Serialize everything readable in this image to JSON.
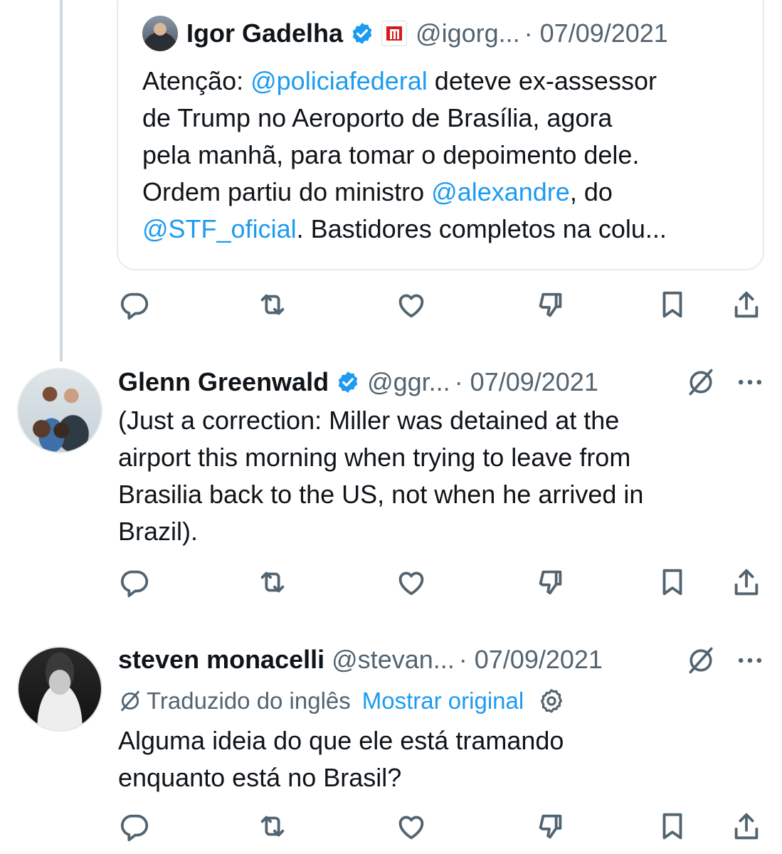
{
  "quoted_tweet": {
    "name": "Igor Gadelha",
    "handle": "@igorg...",
    "date": "· 07/09/2021",
    "lines": [
      [
        {
          "t": "Atenção: ",
          "m": false
        },
        {
          "t": "@policiafederal",
          "m": true
        },
        {
          "t": " deteve ex-assessor",
          "m": false
        }
      ],
      [
        {
          "t": "de Trump  no Aeroporto de Brasília, agora",
          "m": false
        }
      ],
      [
        {
          "t": "pela manhã, para tomar o depoimento dele.",
          "m": false
        }
      ],
      [
        {
          "t": "Ordem partiu do ministro ",
          "m": false
        },
        {
          "t": "@alexandre",
          "m": true
        },
        {
          "t": ", do",
          "m": false
        }
      ],
      [
        {
          "t": "@STF_oficial",
          "m": true
        },
        {
          "t": ". Bastidores completos na colu...",
          "m": false
        }
      ]
    ]
  },
  "tweets": [
    {
      "name": "Glenn Greenwald",
      "handle": "@ggr...",
      "date": "· 07/09/2021",
      "verified": true,
      "lines": [
        "(Just a correction: Miller was detained at the",
        "airport this morning when trying to leave from",
        "Brasilia back to the US, not when he arrived in",
        "Brazil)."
      ]
    },
    {
      "name": "steven monacelli",
      "handle": "@stevan...",
      "date": "· 07/09/2021",
      "verified": false,
      "translation_label": "Traduzido do inglês",
      "show_original": "Mostrar original",
      "lines": [
        "Alguma ideia do que ele está tramando",
        "enquanto está no Brasil?"
      ]
    }
  ],
  "icons": [
    "reply-icon",
    "retweet-icon",
    "like-icon",
    "dislike-icon",
    "bookmark-icon",
    "share-icon",
    "grok-icon",
    "more-icon",
    "verified-badge-icon",
    "gear-icon"
  ],
  "colors": {
    "accent": "#1d9bf0",
    "muted": "#536471",
    "text": "#0f1419",
    "org_badge": "#d7191c"
  }
}
